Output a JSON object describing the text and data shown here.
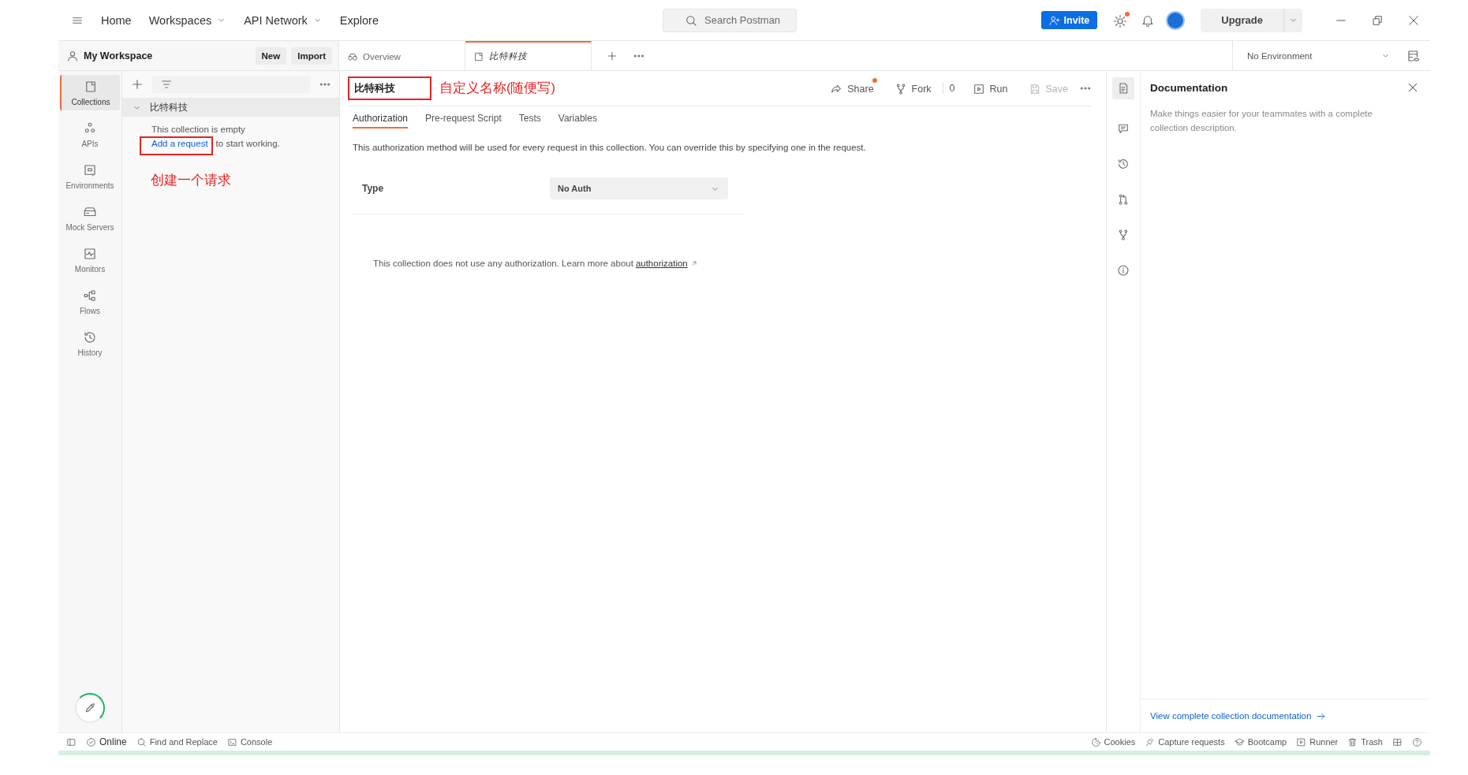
{
  "topbar": {
    "nav": [
      {
        "label": "Home",
        "dropdown": false
      },
      {
        "label": "Workspaces",
        "dropdown": true
      },
      {
        "label": "API Network",
        "dropdown": true
      },
      {
        "label": "Explore",
        "dropdown": false
      }
    ],
    "search": {
      "placeholder": "Search Postman"
    },
    "invite": "Invite",
    "settings_badge": true,
    "upgrade": "Upgrade"
  },
  "workspace": {
    "name": "My Workspace",
    "buttons": [
      "New",
      "Import"
    ]
  },
  "tabs": [
    {
      "label": "Overview",
      "selected": false,
      "italic": false
    },
    {
      "label": "比特科技",
      "selected": true,
      "italic": true
    }
  ],
  "environment": {
    "value": "No Environment"
  },
  "sidebar": {
    "items": [
      {
        "label": "Collections",
        "selected": true
      },
      {
        "label": "APIs",
        "selected": false
      },
      {
        "label": "Environments",
        "selected": false
      },
      {
        "label": "Mock Servers",
        "selected": false
      },
      {
        "label": "Monitors",
        "selected": false
      },
      {
        "label": "Flows",
        "selected": false
      },
      {
        "label": "History",
        "selected": false
      }
    ]
  },
  "collections": {
    "tree": [
      {
        "name": "比特科技",
        "expanded": true,
        "empty_text": "This collection is empty",
        "link": "Add a request",
        "link_rest": "to start working."
      }
    ],
    "annotation": "创建一个请求"
  },
  "editor": {
    "name": "比特科技",
    "annotation": "自定义名称(随便写)",
    "actions": [
      {
        "label": "Share",
        "badge": true,
        "disabled": false
      },
      {
        "label": "Fork",
        "badge": false,
        "disabled": false
      },
      {
        "label": "Run",
        "badge": false,
        "disabled": false
      },
      {
        "label": "Save",
        "badge": false,
        "disabled": true
      }
    ],
    "fork_count": "0",
    "tabs": [
      {
        "label": "Authorization",
        "selected": true
      },
      {
        "label": "Pre-request Script",
        "selected": false
      },
      {
        "label": "Tests",
        "selected": false
      },
      {
        "label": "Variables",
        "selected": false
      }
    ],
    "description": "This authorization method will be used for every request in this collection. You can override this by specifying one in the request.",
    "type_label": "Type",
    "type_value": "No Auth",
    "note": "This collection does not use any authorization. Learn more about",
    "note_link": "authorization"
  },
  "documentation": {
    "title": "Documentation",
    "placeholder": "Make things easier for your teammates with a complete collection description.",
    "link": "View complete collection documentation"
  },
  "status_bar": {
    "left": [
      "Online",
      "Find and Replace",
      "Console"
    ],
    "right": [
      "Cookies",
      "Capture requests",
      "Bootcamp",
      "Runner",
      "Trash"
    ]
  }
}
